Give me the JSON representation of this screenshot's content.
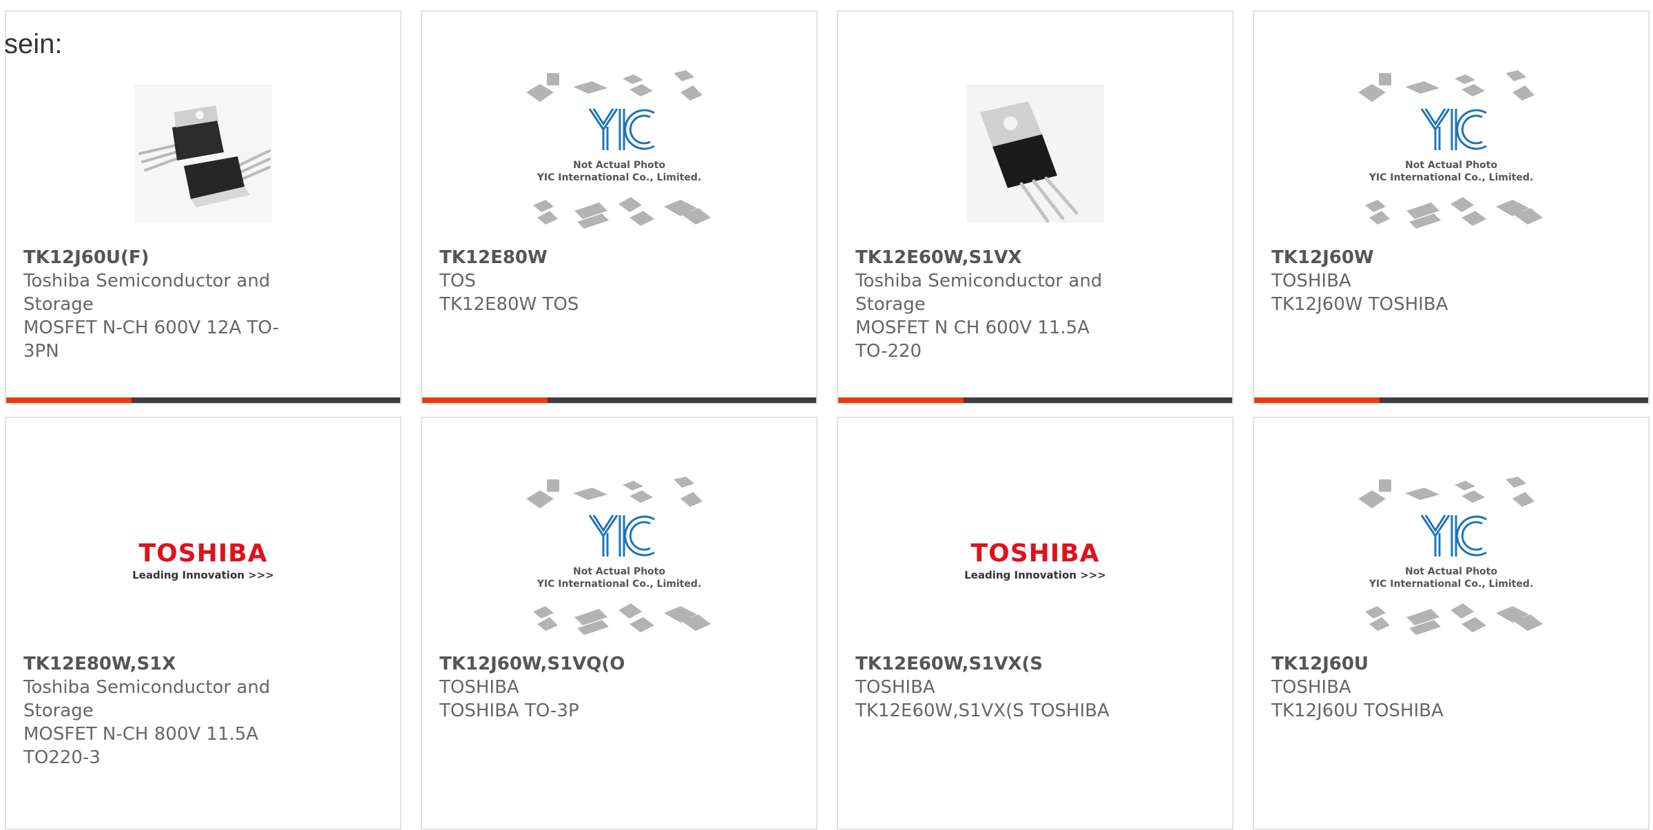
{
  "intro_text": "sein:",
  "colors": {
    "accent": "#ea3c0e",
    "bar": "#3d3d3d",
    "toshiba_red": "#e0101c",
    "yic_blue": "#1f73b7"
  },
  "placeholder": {
    "line1": "Not Actual Photo",
    "line2": "YIC International Co., Limited."
  },
  "toshiba_logo": {
    "word": "TOSHIBA",
    "tagline": "Leading Innovation >>>"
  },
  "products": [
    {
      "part": "TK12J60U(F)",
      "manufacturer": "Toshiba Semiconductor and Storage",
      "description": "MOSFET N-CH 600V 12A TO-3PN",
      "image": "mosfet-to3pn-photo"
    },
    {
      "part": "TK12E80W",
      "manufacturer": "TOS",
      "description": "TK12E80W TOS",
      "image": "yic-placeholder"
    },
    {
      "part": "TK12E60W,S1VX",
      "manufacturer": "Toshiba Semiconductor and Storage",
      "description": "MOSFET N CH 600V 11.5A TO-220",
      "image": "to220-photo"
    },
    {
      "part": "TK12J60W",
      "manufacturer": "TOSHIBA",
      "description": "TK12J60W TOSHIBA",
      "image": "yic-placeholder"
    },
    {
      "part": "TK12E80W,S1X",
      "manufacturer": "Toshiba Semiconductor and Storage",
      "description": "MOSFET N-CH 800V 11.5A TO220-3",
      "image": "toshiba-logo"
    },
    {
      "part": "TK12J60W,S1VQ(O",
      "manufacturer": "TOSHIBA",
      "description": "TOSHIBA TO-3P",
      "image": "yic-placeholder"
    },
    {
      "part": "TK12E60W,S1VX(S",
      "manufacturer": "TOSHIBA",
      "description": "TK12E60W,S1VX(S TOSHIBA",
      "image": "toshiba-logo"
    },
    {
      "part": "TK12J60U",
      "manufacturer": "TOSHIBA",
      "description": "TK12J60U TOSHIBA",
      "image": "yic-placeholder"
    }
  ]
}
